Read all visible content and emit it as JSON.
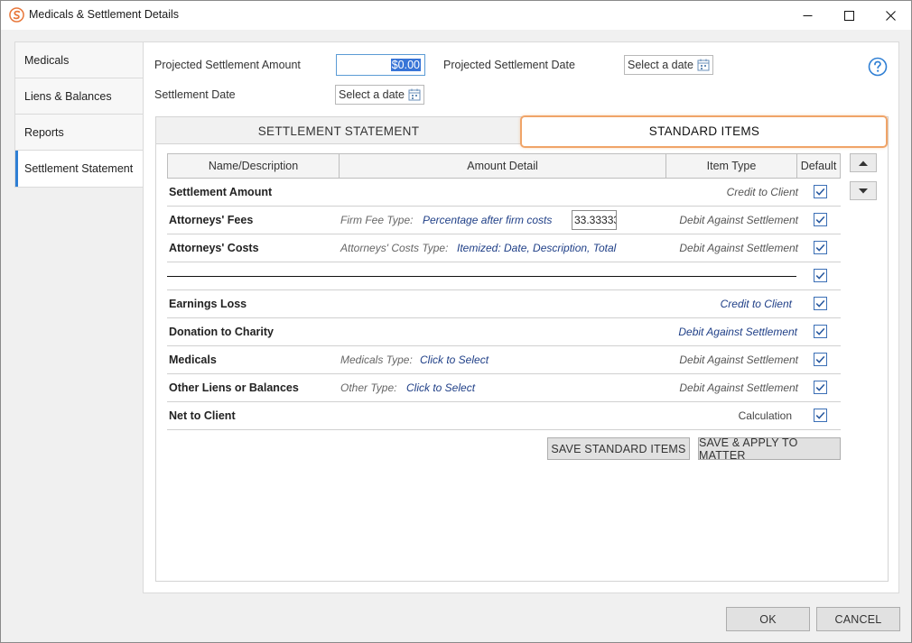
{
  "window": {
    "title": "Medicals & Settlement Details",
    "controls": {
      "minimize": "—",
      "maximize": "☐",
      "close": "✕"
    }
  },
  "sidebar": {
    "items": [
      {
        "label": "Medicals"
      },
      {
        "label": "Liens & Balances"
      },
      {
        "label": "Reports"
      },
      {
        "label": "Settlement Statement",
        "active": true
      }
    ]
  },
  "form": {
    "projected_amount_label": "Projected Settlement Amount",
    "projected_amount_value": "$0.00",
    "projected_date_label": "Projected Settlement Date",
    "projected_date_placeholder": "Select a date",
    "settlement_date_label": "Settlement Date",
    "settlement_date_placeholder": "Select a date"
  },
  "tabs": [
    {
      "label": "SETTLEMENT STATEMENT",
      "active": false
    },
    {
      "label": "STANDARD ITEMS",
      "active": true
    }
  ],
  "table": {
    "headers": [
      "Name/Description",
      "Amount Detail",
      "Item Type",
      "Default"
    ],
    "rows": [
      {
        "name": "Settlement Amount",
        "sub_label": "",
        "detail": "",
        "extra": "",
        "type": "Credit to Client",
        "default": true
      },
      {
        "name": "Attorneys' Fees",
        "sub_label": "Firm Fee Type:",
        "detail": "Percentage after firm costs",
        "extra": "33.33333",
        "type": "Debit Against Settlement",
        "default": true
      },
      {
        "name": "Attorneys' Costs",
        "sub_label": "Attorneys' Costs Type:",
        "detail": "Itemized: Date, Description, Total",
        "extra": "",
        "type": "Debit Against Settlement",
        "default": true
      },
      {
        "name": "",
        "sub_label": "",
        "detail": "",
        "extra": "",
        "type": "",
        "default": true
      },
      {
        "name": "Earnings Loss",
        "sub_label": "",
        "detail": "",
        "extra": "",
        "type": "Credit to Client",
        "default": true
      },
      {
        "name": "Donation to Charity",
        "sub_label": "",
        "detail": "",
        "extra": "",
        "type": "Debit Against Settlement",
        "default": true
      },
      {
        "name": "Medicals",
        "sub_label": "Medicals Type:",
        "detail": "Click to Select",
        "extra": "",
        "type": "Debit Against Settlement",
        "default": true
      },
      {
        "name": "Other Liens or Balances",
        "sub_label": "Other Type:",
        "detail": "Click to Select",
        "extra": "",
        "type": "Debit Against Settlement",
        "default": true
      },
      {
        "name": "Net to Client",
        "sub_label": "",
        "detail": "",
        "extra": "",
        "type": "Calculation",
        "default": true
      }
    ]
  },
  "buttons": {
    "save_standard": "SAVE STANDARD ITEMS",
    "save_apply": "SAVE & APPLY TO MATTER",
    "ok": "OK",
    "cancel": "CANCEL"
  },
  "colors": {
    "accent_blue": "#2f7fd4",
    "link_blue": "#1f3f87",
    "tab_highlight": "#f0a468",
    "brand_orange": "#e8773a"
  }
}
